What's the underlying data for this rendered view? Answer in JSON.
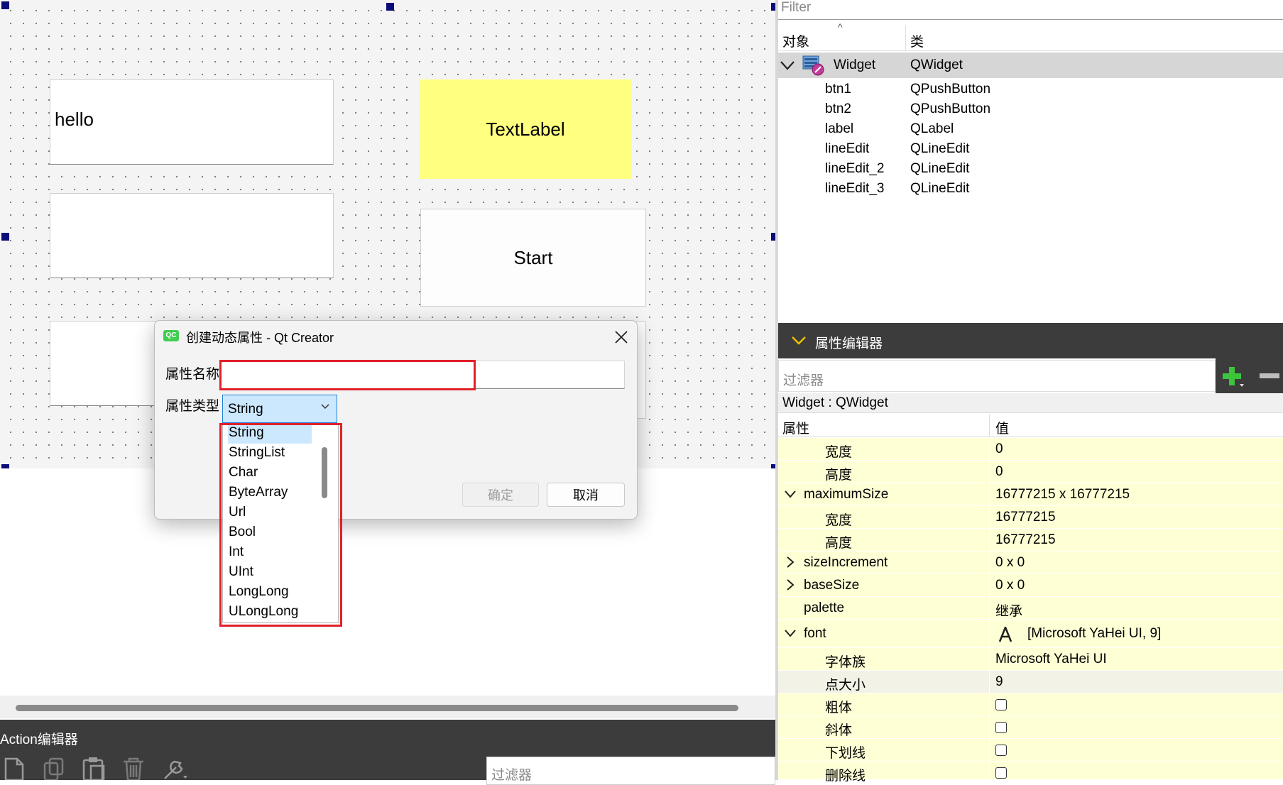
{
  "form": {
    "lineedit1_text": "hello",
    "label_text": "TextLabel",
    "button_start": "Start"
  },
  "action_editor": {
    "title": "Action编辑器",
    "filter_placeholder": "过滤器"
  },
  "object_inspector": {
    "filter_placeholder": "Filter",
    "col_object": "对象",
    "col_class": "类",
    "root": {
      "name": "Widget",
      "class": "QWidget"
    },
    "children": [
      {
        "name": "btn1",
        "class": "QPushButton"
      },
      {
        "name": "btn2",
        "class": "QPushButton"
      },
      {
        "name": "label",
        "class": "QLabel"
      },
      {
        "name": "lineEdit",
        "class": "QLineEdit"
      },
      {
        "name": "lineEdit_2",
        "class": "QLineEdit"
      },
      {
        "name": "lineEdit_3",
        "class": "QLineEdit"
      }
    ]
  },
  "property_editor": {
    "title": "属性编辑器",
    "filter_placeholder": "过滤器",
    "context": "Widget : QWidget",
    "col_property": "属性",
    "col_value": "值",
    "rows": [
      {
        "name": "宽度",
        "value": "0"
      },
      {
        "name": "高度",
        "value": "0"
      },
      {
        "name": "maximumSize",
        "value": "16777215 x 16777215"
      },
      {
        "name": "宽度",
        "value": "16777215"
      },
      {
        "name": "高度",
        "value": "16777215"
      },
      {
        "name": "sizeIncrement",
        "value": "0 x 0"
      },
      {
        "name": "baseSize",
        "value": "0 x 0"
      },
      {
        "name": "palette",
        "value": "继承"
      },
      {
        "name": "font",
        "value": "[Microsoft YaHei UI, 9]"
      },
      {
        "name": "字体族",
        "value": "Microsoft YaHei UI"
      },
      {
        "name": "点大小",
        "value": "9"
      },
      {
        "name": "粗体",
        "value": ""
      },
      {
        "name": "斜体",
        "value": ""
      },
      {
        "name": "下划线",
        "value": ""
      },
      {
        "name": "删除线",
        "value": ""
      }
    ],
    "colors": {
      "row_yellow": "#ffffd5",
      "row_highlight": "#f2f2e6"
    }
  },
  "dialog": {
    "title": "创建动态属性 - Qt Creator",
    "name_label": "属性名称",
    "name_value": "",
    "type_label": "属性类型",
    "type_value": "String",
    "ok_label": "确定",
    "cancel_label": "取消",
    "type_options": [
      "String",
      "StringList",
      "Char",
      "ByteArray",
      "Url",
      "Bool",
      "Int",
      "UInt",
      "LongLong",
      "ULongLong"
    ]
  },
  "colors": {
    "canvas_bg": "#f4f4f4",
    "label_yellow": "#ffff80",
    "dark_bar": "#3c3c3c",
    "highlight_red": "#e0202a",
    "selection_blue": "#cce8ff"
  }
}
